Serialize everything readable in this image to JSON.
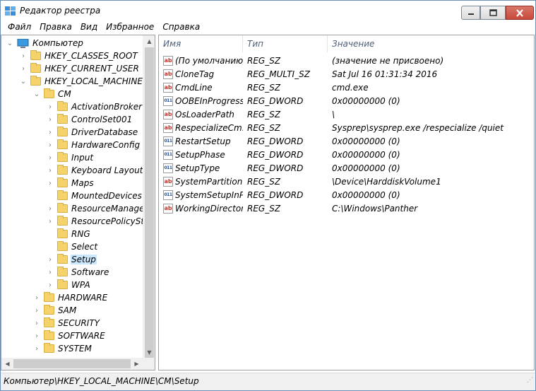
{
  "window": {
    "title": "Редактор реестра",
    "minimize_icon": "minimize-icon",
    "maximize_icon": "maximize-icon",
    "close_icon": "close-icon"
  },
  "menu": [
    "Файл",
    "Правка",
    "Вид",
    "Избранное",
    "Справка"
  ],
  "tree": [
    {
      "label": "Компьютер",
      "depth": 0,
      "expander": "open",
      "icon": "computer-icon"
    },
    {
      "label": "HKEY_CLASSES_ROOT",
      "depth": 1,
      "expander": "closed",
      "icon": "folder-icon"
    },
    {
      "label": "HKEY_CURRENT_USER",
      "depth": 1,
      "expander": "closed",
      "icon": "folder-icon"
    },
    {
      "label": "HKEY_LOCAL_MACHINE",
      "depth": 1,
      "expander": "open",
      "icon": "folder-icon"
    },
    {
      "label": "CM",
      "depth": 2,
      "expander": "open",
      "icon": "folder-icon"
    },
    {
      "label": "ActivationBroker",
      "depth": 3,
      "expander": "closed",
      "icon": "folder-icon"
    },
    {
      "label": "ControlSet001",
      "depth": 3,
      "expander": "closed",
      "icon": "folder-icon"
    },
    {
      "label": "DriverDatabase",
      "depth": 3,
      "expander": "closed",
      "icon": "folder-icon"
    },
    {
      "label": "HardwareConfig",
      "depth": 3,
      "expander": "closed",
      "icon": "folder-icon"
    },
    {
      "label": "Input",
      "depth": 3,
      "expander": "closed",
      "icon": "folder-icon"
    },
    {
      "label": "Keyboard Layout",
      "depth": 3,
      "expander": "closed",
      "icon": "folder-icon"
    },
    {
      "label": "Maps",
      "depth": 3,
      "expander": "closed",
      "icon": "folder-icon"
    },
    {
      "label": "MountedDevices",
      "depth": 3,
      "expander": "none",
      "icon": "folder-icon"
    },
    {
      "label": "ResourceManager",
      "depth": 3,
      "expander": "closed",
      "icon": "folder-icon"
    },
    {
      "label": "ResourcePolicyStor",
      "depth": 3,
      "expander": "closed",
      "icon": "folder-icon"
    },
    {
      "label": "RNG",
      "depth": 3,
      "expander": "none",
      "icon": "folder-icon"
    },
    {
      "label": "Select",
      "depth": 3,
      "expander": "none",
      "icon": "folder-icon"
    },
    {
      "label": "Setup",
      "depth": 3,
      "expander": "closed",
      "icon": "folder-icon",
      "selected": true
    },
    {
      "label": "Software",
      "depth": 3,
      "expander": "closed",
      "icon": "folder-icon"
    },
    {
      "label": "WPA",
      "depth": 3,
      "expander": "closed",
      "icon": "folder-icon"
    },
    {
      "label": "HARDWARE",
      "depth": 2,
      "expander": "closed",
      "icon": "folder-icon"
    },
    {
      "label": "SAM",
      "depth": 2,
      "expander": "closed",
      "icon": "folder-icon"
    },
    {
      "label": "SECURITY",
      "depth": 2,
      "expander": "closed",
      "icon": "folder-icon"
    },
    {
      "label": "SOFTWARE",
      "depth": 2,
      "expander": "closed",
      "icon": "folder-icon"
    },
    {
      "label": "SYSTEM",
      "depth": 2,
      "expander": "closed",
      "icon": "folder-icon"
    }
  ],
  "list": {
    "headers": [
      "Имя",
      "Тип",
      "Значение"
    ],
    "rows": [
      {
        "icon": "string-value-icon",
        "kind": "sz",
        "name": "(По умолчанию)",
        "type": "REG_SZ",
        "value": "(значение не присвоено)"
      },
      {
        "icon": "string-value-icon",
        "kind": "sz",
        "name": "CloneTag",
        "type": "REG_MULTI_SZ",
        "value": "Sat Jul 16 01:31:34 2016"
      },
      {
        "icon": "string-value-icon",
        "kind": "sz",
        "name": "CmdLine",
        "type": "REG_SZ",
        "value": "cmd.exe"
      },
      {
        "icon": "dword-value-icon",
        "kind": "dw",
        "name": "OOBEInProgress",
        "type": "REG_DWORD",
        "value": "0x00000000 (0)"
      },
      {
        "icon": "string-value-icon",
        "kind": "sz",
        "name": "OsLoaderPath",
        "type": "REG_SZ",
        "value": "\\"
      },
      {
        "icon": "string-value-icon",
        "kind": "sz",
        "name": "RespecializeCm...",
        "type": "REG_SZ",
        "value": "Sysprep\\sysprep.exe /respecialize /quiet"
      },
      {
        "icon": "dword-value-icon",
        "kind": "dw",
        "name": "RestartSetup",
        "type": "REG_DWORD",
        "value": "0x00000000 (0)"
      },
      {
        "icon": "dword-value-icon",
        "kind": "dw",
        "name": "SetupPhase",
        "type": "REG_DWORD",
        "value": "0x00000000 (0)"
      },
      {
        "icon": "dword-value-icon",
        "kind": "dw",
        "name": "SetupType",
        "type": "REG_DWORD",
        "value": "0x00000000 (0)"
      },
      {
        "icon": "string-value-icon",
        "kind": "sz",
        "name": "SystemPartition",
        "type": "REG_SZ",
        "value": "\\Device\\HarddiskVolume1"
      },
      {
        "icon": "dword-value-icon",
        "kind": "dw",
        "name": "SystemSetupInP...",
        "type": "REG_DWORD",
        "value": "0x00000000 (0)"
      },
      {
        "icon": "string-value-icon",
        "kind": "sz",
        "name": "WorkingDirectory",
        "type": "REG_SZ",
        "value": "C:\\Windows\\Panther"
      }
    ]
  },
  "status": {
    "path": "Компьютер\\HKEY_LOCAL_MACHINE\\CM\\Setup"
  },
  "colors": {
    "selection": "#cce8ff",
    "folder": "#f6d36a",
    "close_button": "#c8493a",
    "header_text": "#4c607a"
  }
}
